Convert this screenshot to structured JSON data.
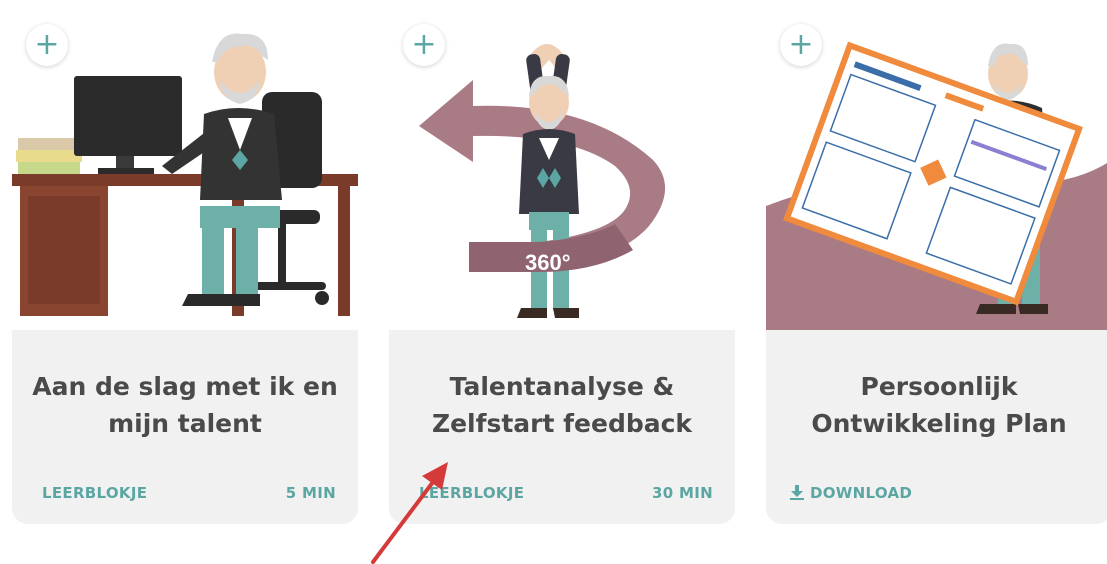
{
  "cards": [
    {
      "title_line1": "Aan de slag met ik en",
      "title_line2": "mijn talent",
      "type_label": "LEERBLOKJE",
      "duration": "5 MIN",
      "plus_symbol": "+"
    },
    {
      "title_line1": "Talentanalyse &",
      "title_line2": "Zelfstart feedback",
      "type_label": "LEERBLOKJE",
      "duration": "30 MIN",
      "plus_symbol": "+",
      "badge": "360°"
    },
    {
      "title_line1": "Persoonlijk",
      "title_line2": "Ontwikkeling Plan",
      "type_label": "DOWNLOAD",
      "plus_symbol": "+"
    }
  ],
  "colors": {
    "accent": "#5ba6a3",
    "title_text": "#4a4a4a",
    "card_bg": "#f1f1f1",
    "mauve": "#a97b85",
    "annotation_arrow": "#d43a3a"
  },
  "icons": [
    "plus-icon",
    "download-icon",
    "annotation-arrow"
  ]
}
